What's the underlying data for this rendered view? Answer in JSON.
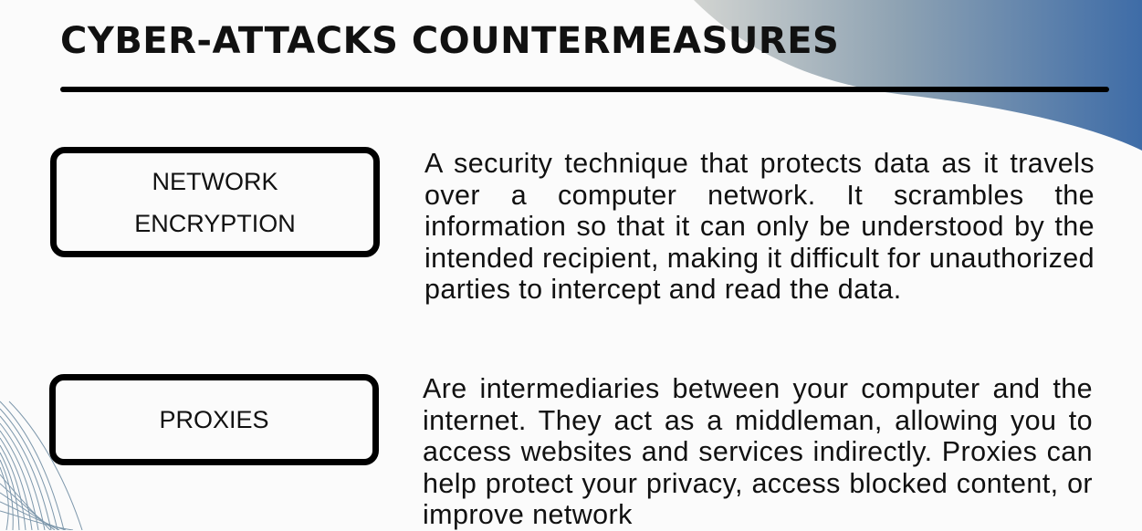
{
  "header": {
    "title": "CYBER-ATTACKS COUNTERMEASURES"
  },
  "items": [
    {
      "term": "NETWORK ENCRYPTION",
      "description": "A security technique that protects data as it travels over a computer network. It scrambles the information so that it can only be understood by the intended recipient, making it difficult for unauthorized parties to intercept and read the data."
    },
    {
      "term": "PROXIES",
      "description": "Are intermediaries between your computer and the internet. They act as a middleman, allowing you to access websites and services indirectly. Proxies can help protect your privacy, access blocked content, or improve network"
    }
  ],
  "colors": {
    "blob_light": "#c9ccc9",
    "blob_dark": "#3f6ea8",
    "wave_lines": "#6f8fa6"
  }
}
